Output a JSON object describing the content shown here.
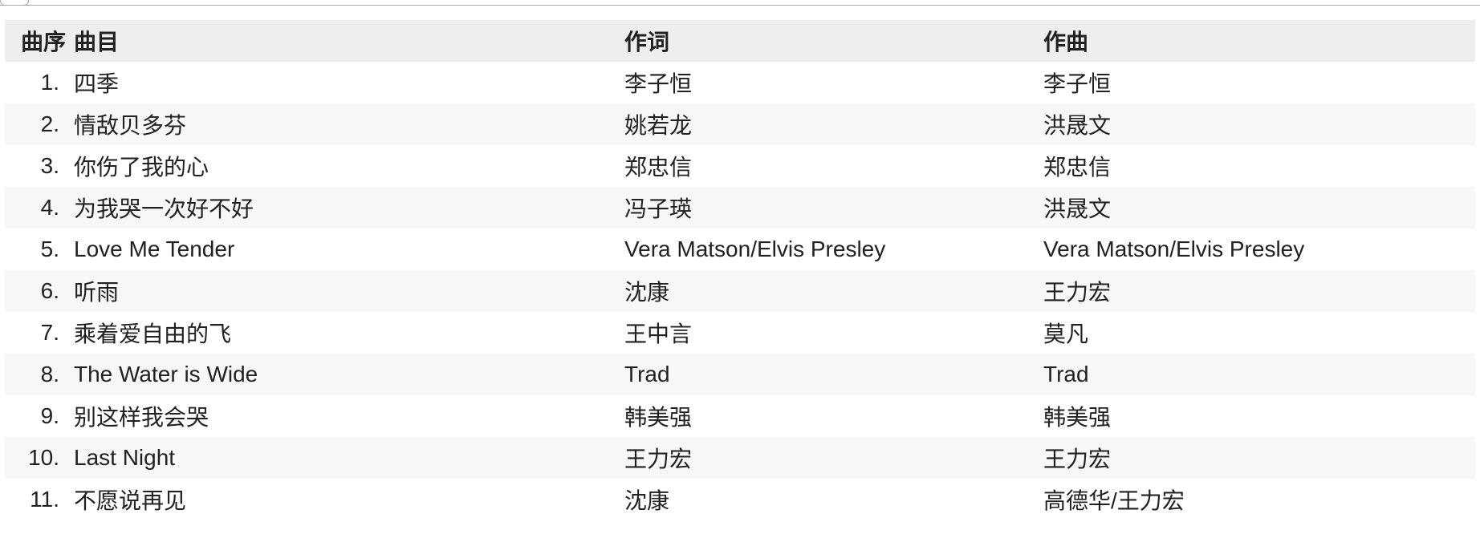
{
  "table": {
    "headers": {
      "number": "曲序",
      "title": "曲目",
      "lyricist": "作词",
      "composer": "作曲"
    },
    "rows": [
      {
        "number": "1.",
        "title": "四季",
        "lyricist": "李子恒",
        "composer": "李子恒"
      },
      {
        "number": "2.",
        "title": "情敌贝多芬",
        "lyricist": "姚若龙",
        "composer": "洪晟文"
      },
      {
        "number": "3.",
        "title": "你伤了我的心",
        "lyricist": "郑忠信",
        "composer": "郑忠信"
      },
      {
        "number": "4.",
        "title": "为我哭一次好不好",
        "lyricist": "冯子瑛",
        "composer": "洪晟文"
      },
      {
        "number": "5.",
        "title": "Love Me Tender",
        "lyricist": "Vera Matson/Elvis Presley",
        "composer": "Vera Matson/Elvis Presley"
      },
      {
        "number": "6.",
        "title": "听雨",
        "lyricist": "沈康",
        "composer": "王力宏"
      },
      {
        "number": "7.",
        "title": "乘着爱自由的飞",
        "lyricist": "王中言",
        "composer": "莫凡"
      },
      {
        "number": "8.",
        "title": "The Water is Wide",
        "lyricist": "Trad",
        "composer": "Trad"
      },
      {
        "number": "9.",
        "title": "别这样我会哭",
        "lyricist": "韩美强",
        "composer": "韩美强"
      },
      {
        "number": "10.",
        "title": "Last Night",
        "lyricist": "王力宏",
        "composer": "王力宏"
      },
      {
        "number": "11.",
        "title": "不愿说再见",
        "lyricist": "沈康",
        "composer": "高德华/王力宏"
      }
    ]
  }
}
